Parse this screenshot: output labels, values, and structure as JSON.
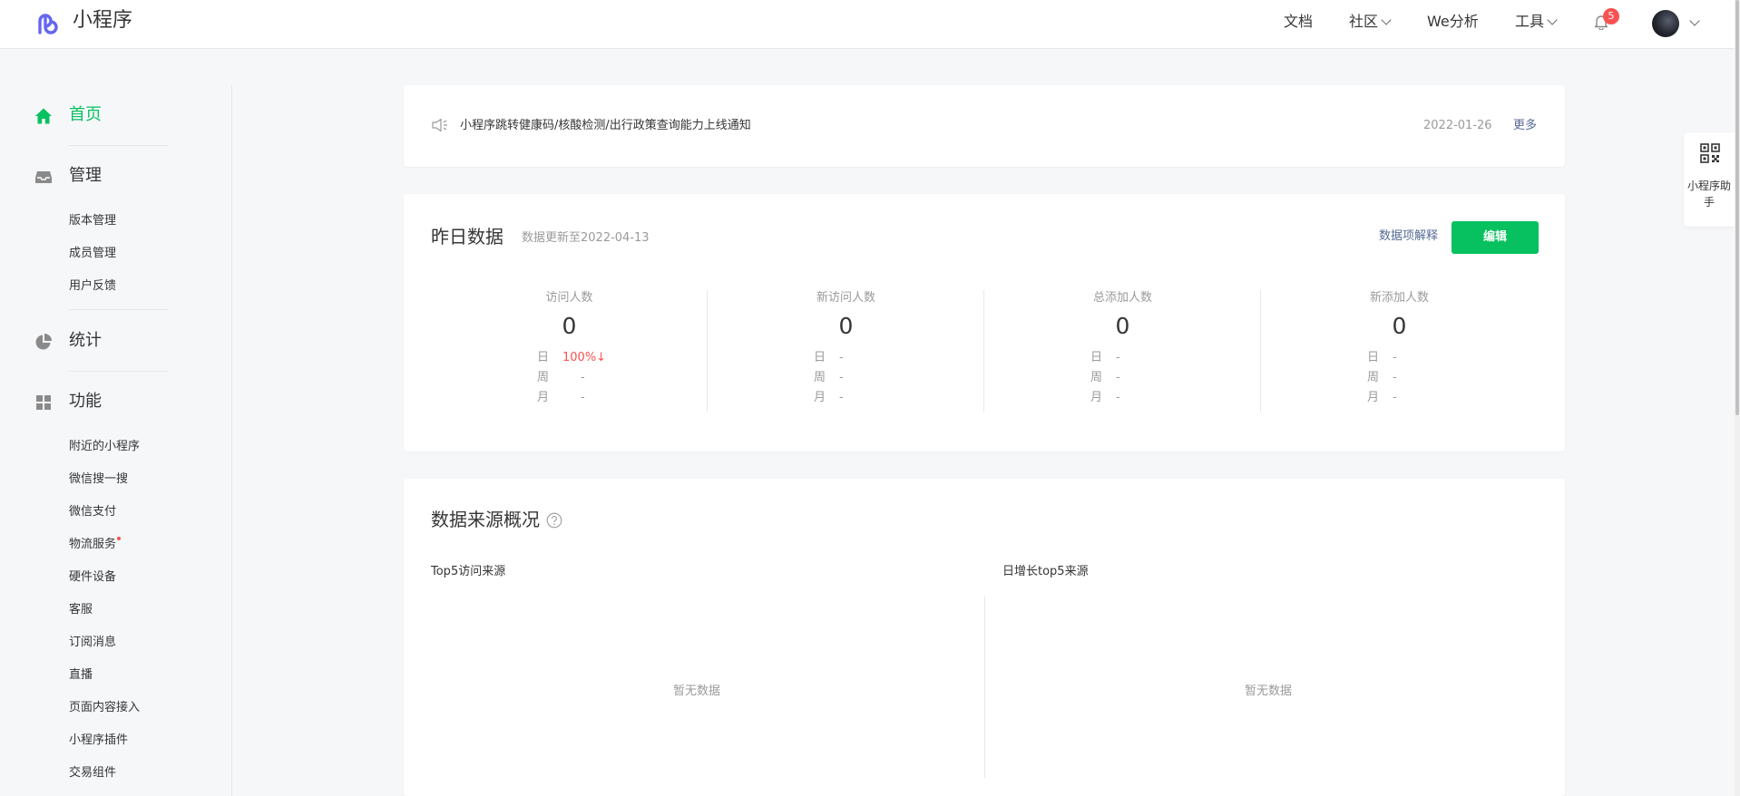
{
  "header": {
    "brand": "小程序",
    "nav": [
      "文档",
      "社区",
      "We分析",
      "工具"
    ],
    "notification_count": "5"
  },
  "sidebar": {
    "home": "首页",
    "manage": {
      "label": "管理",
      "items": [
        "版本管理",
        "成员管理",
        "用户反馈"
      ]
    },
    "stats": "统计",
    "features": {
      "label": "功能",
      "items": [
        "附近的小程序",
        "微信搜一搜",
        "微信支付",
        "物流服务",
        "硬件设备",
        "客服",
        "订阅消息",
        "直播",
        "页面内容接入",
        "小程序插件",
        "交易组件"
      ]
    }
  },
  "notice": {
    "text": "小程序跳转健康码/核酸检测/出行政策查询能力上线通知",
    "date": "2022-01-26",
    "more": "更多"
  },
  "yesterday": {
    "title": "昨日数据",
    "updated": "数据更新至2022-04-13",
    "explain": "数据项解释",
    "edit": "编辑",
    "row_labels": [
      "日",
      "周",
      "月"
    ],
    "metrics": [
      {
        "label": "访问人数",
        "value": "0",
        "day": "100%↓",
        "week": "-",
        "month": "-"
      },
      {
        "label": "新访问人数",
        "value": "0",
        "day": "-",
        "week": "-",
        "month": "-"
      },
      {
        "label": "总添加人数",
        "value": "0",
        "day": "-",
        "week": "-",
        "month": "-"
      },
      {
        "label": "新添加人数",
        "value": "0",
        "day": "-",
        "week": "-",
        "month": "-"
      }
    ]
  },
  "source": {
    "title": "数据来源概况",
    "left_title": "Top5访问来源",
    "right_title": "日增长top5来源",
    "empty": "暂无数据"
  },
  "helper": {
    "label": "小程序助手"
  },
  "colors": {
    "accent": "#07c160",
    "link": "#576b95",
    "alert": "#fa5151"
  }
}
